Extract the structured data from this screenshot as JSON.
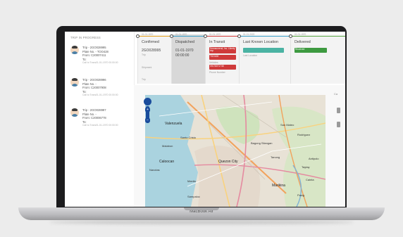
{
  "device": {
    "base_label": "MacBook Air"
  },
  "trips_panel": {
    "heading": "TRIP IN PROGRESS",
    "trips": [
      {
        "trip": "Trip - 2GO028995",
        "plate": "Plate No. - TOO428",
        "from": "From: C20007411",
        "to": "To:",
        "meta": "Call to Trans01-01-1970 00:00:00"
      },
      {
        "trip": "Trip - 2GO028996",
        "plate": "Plate No. -",
        "from": "From: C20007908",
        "to": "To:",
        "meta": "Call to Trans01-01-1970 00:00:00"
      },
      {
        "trip": "Trip - 2GO028997",
        "plate": "Plate No. -",
        "from": "From: C20006778",
        "to": "To:",
        "meta": "Call to Trans01-01-1970 00:00:00"
      }
    ]
  },
  "status_timeline": {
    "columns": [
      {
        "date": "01-01-1970",
        "title": "Confirmed",
        "value1": "2GO028995",
        "sub1": "Trip",
        "sub2": "Shipment",
        "sub3": "Trip",
        "bar_color": "#e6a11c"
      },
      {
        "date": "01-01-1970",
        "title": "Dispatched",
        "value1": "01-01-1970",
        "value2": "00:00:00",
        "bar_color": "#3aa0c9"
      },
      {
        "date": "01-01-1970",
        "title": "In Transit",
        "tag1": "Demacorend, Inc. Liberty exp",
        "tag2": "TDO428",
        "sub1": "Vehicles",
        "tag3": "09178071748",
        "sub2": "Phone Number",
        "bar_color": "#d43d3d",
        "tag_color": "#cf3a3a"
      },
      {
        "date": "01-01-2022",
        "title": "Last Known Location",
        "sub1": "Last Location",
        "bar_color": "#3aa0c9",
        "bar_teal": "#4bb3a3"
      },
      {
        "date": "01-01-1970",
        "title": "Delivered",
        "tag1": "Received",
        "bar_color": "#5aa845",
        "tag_color": "#3d9a40"
      }
    ]
  },
  "map": {
    "labels": [
      "Valenzuela",
      "Quezon City",
      "Caloocan",
      "San Mateo",
      "Marikina",
      "Manila",
      "Pasig",
      "Antipolo",
      "Taytay",
      "Navotas",
      "Malabon",
      "Santo Cristo",
      "Bagong Silangan",
      "Tanong",
      "Sampaloc",
      "Rodriguez",
      "Cainta"
    ],
    "zoom_in": "+",
    "zoom_out": "−",
    "side_label": "Ca"
  }
}
